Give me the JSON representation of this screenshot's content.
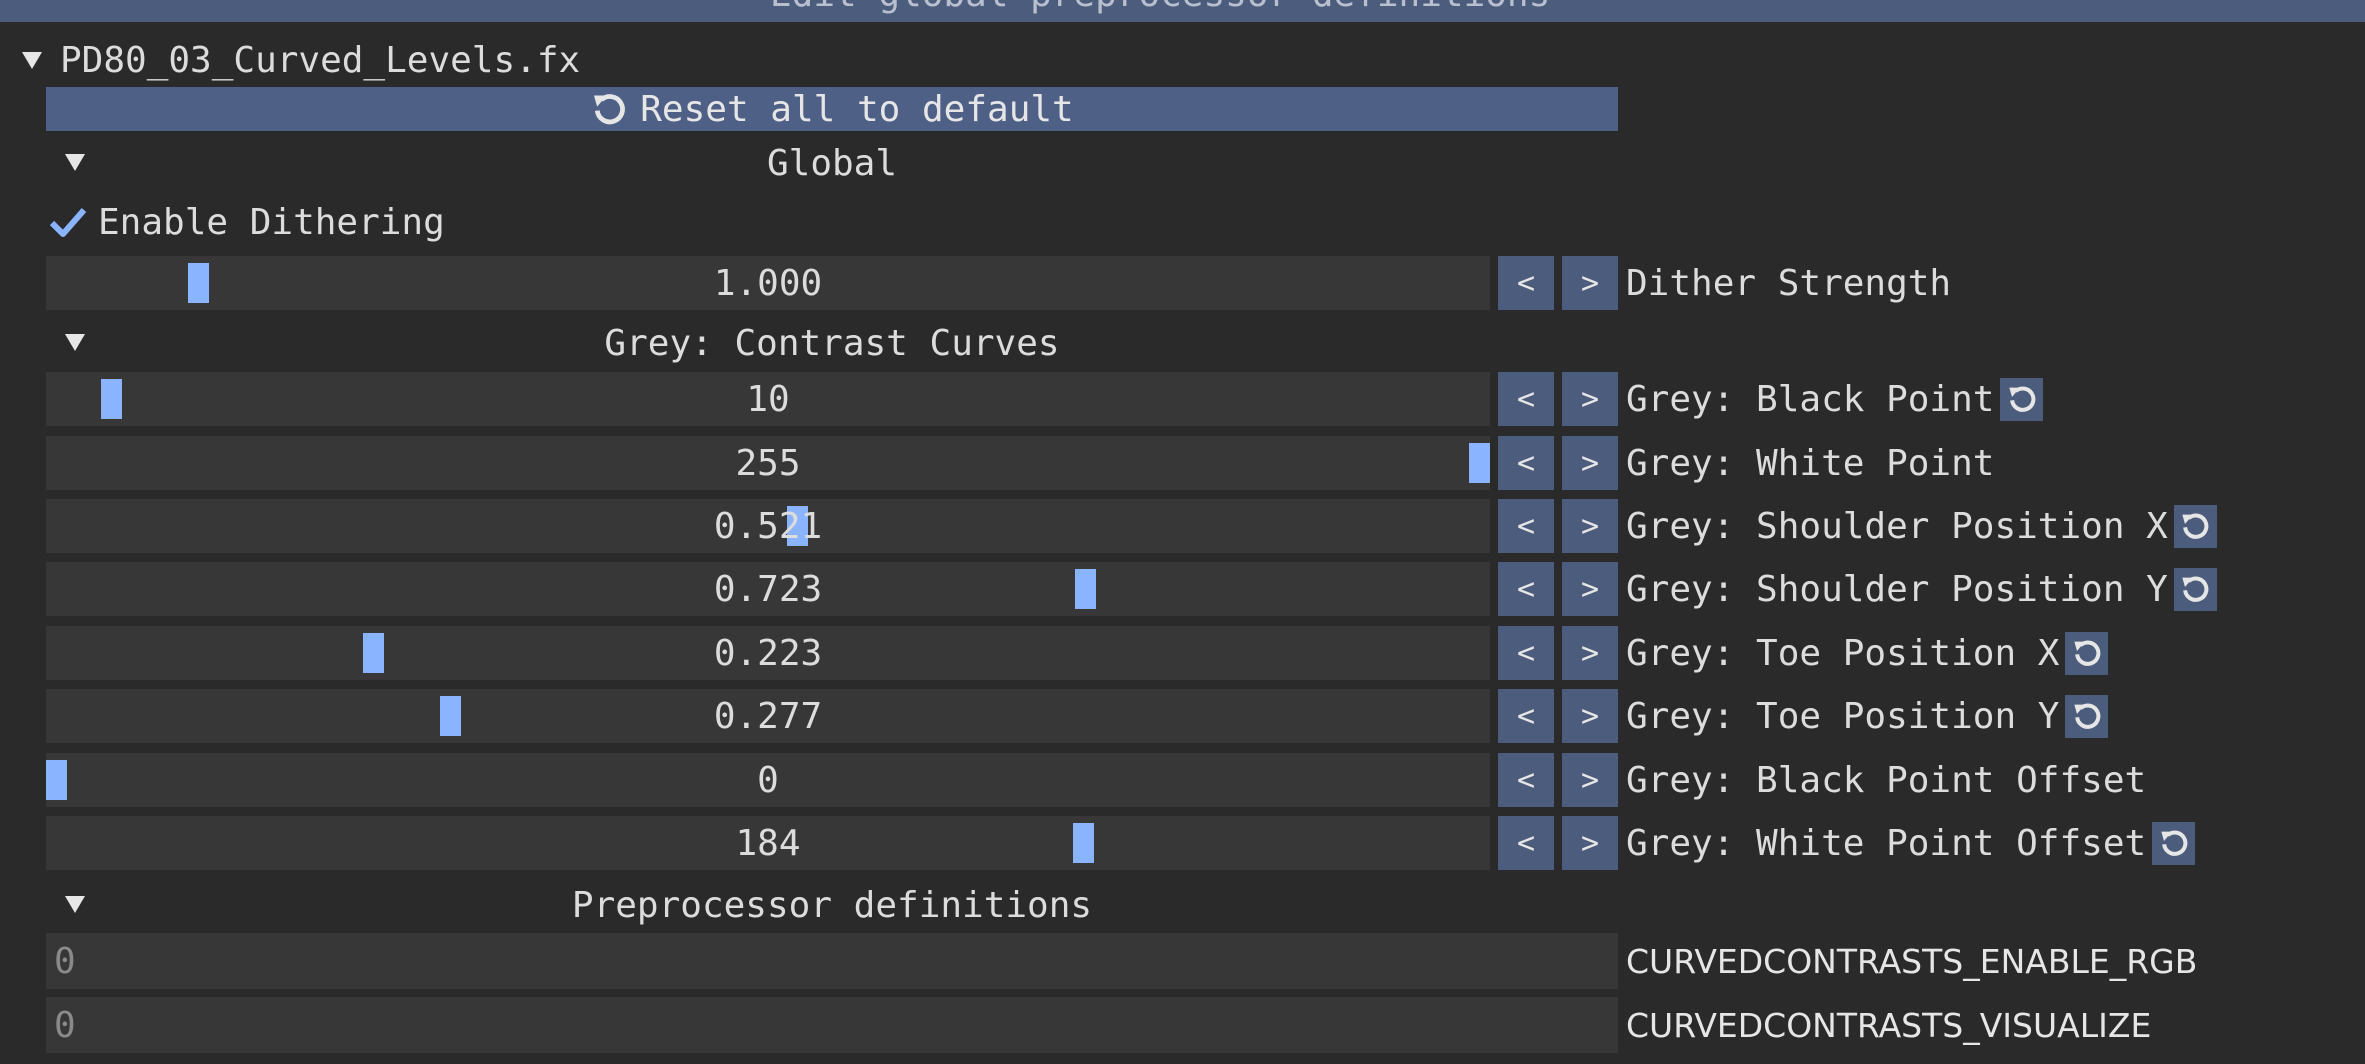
{
  "header": {
    "title": "Edit global preprocessor definitions"
  },
  "effect": {
    "file_name": "PD80_03_Curved_Levels.fx",
    "reset_all_label": "Reset all to default"
  },
  "sections": {
    "global": "Global",
    "grey": "Grey: Contrast Curves",
    "preprocessor": "Preprocessor definitions"
  },
  "checkbox": {
    "label": "Enable Dithering",
    "checked": true
  },
  "controls": [
    {
      "label": "Dither Strength",
      "value": "1.000",
      "fraction": 0.1,
      "reset": false
    },
    {
      "label": "Grey: Black Point",
      "value": "10",
      "fraction": 0.039,
      "reset": true
    },
    {
      "label": "Grey: White Point",
      "value": "255",
      "fraction": 1.0,
      "reset": false
    },
    {
      "label": "Grey: Shoulder Position X",
      "value": "0.521",
      "fraction": 0.521,
      "reset": true
    },
    {
      "label": "Grey: Shoulder Position Y",
      "value": "0.723",
      "fraction": 0.723,
      "reset": true
    },
    {
      "label": "Grey: Toe Position X",
      "value": "0.223",
      "fraction": 0.223,
      "reset": true
    },
    {
      "label": "Grey: Toe Position Y",
      "value": "0.277",
      "fraction": 0.277,
      "reset": true
    },
    {
      "label": "Grey: Black Point Offset",
      "value": "0",
      "fraction": 0.0,
      "reset": false
    },
    {
      "label": "Grey: White Point Offset",
      "value": "184",
      "fraction": 0.722,
      "reset": true
    }
  ],
  "stepper": {
    "decrement": "<",
    "increment": ">"
  },
  "definitions": [
    {
      "name": "CURVEDCONTRASTS_ENABLE_RGB",
      "value": "0"
    },
    {
      "name": "CURVEDCONTRASTS_VISUALIZE",
      "value": "0"
    }
  ],
  "icons": {
    "reset": "reset-icon",
    "check": "check-icon",
    "collapse": "triangle-down-icon"
  },
  "colors": {
    "button": "#4c5c7c",
    "grab": "#8ab4ff",
    "frame": "#373737",
    "background": "#2a2a2a"
  }
}
